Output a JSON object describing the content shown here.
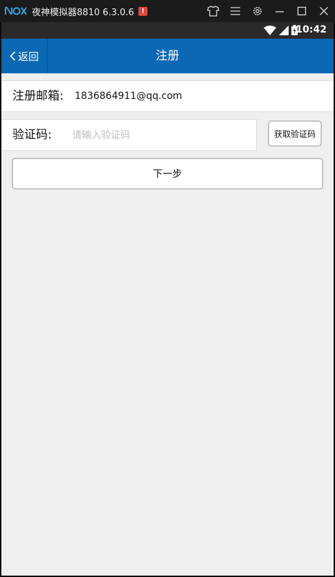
{
  "emulator": {
    "title": "夜神模拟器8810 6.3.0.6",
    "alert_badge": "!",
    "controls": [
      "shirt-icon",
      "menu-icon",
      "gear-icon",
      "minimize-icon",
      "maximize-icon",
      "close-icon"
    ]
  },
  "status_bar": {
    "time": "10:42",
    "icons": [
      "wifi-icon",
      "signal-icon",
      "battery-icon"
    ]
  },
  "header": {
    "back_label": "返回",
    "title": "注册",
    "color": "#0b68b5"
  },
  "form": {
    "email_label": "注册邮箱:",
    "email_value": "1836864911@qq.com",
    "code_label": "验证码:",
    "code_placeholder": "请输入验证码",
    "get_code_label": "获取验证码",
    "next_label": "下一步"
  }
}
